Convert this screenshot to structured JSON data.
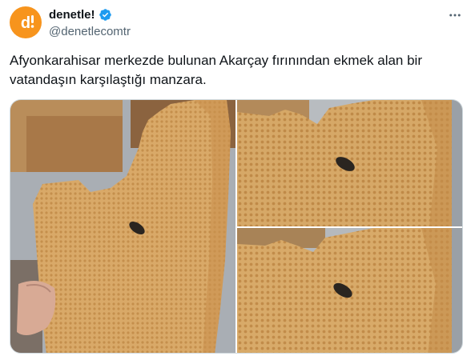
{
  "account": {
    "display_name": "denetle!",
    "handle": "@denetlecomtr",
    "avatar_icon": "denetle-logo",
    "verified_icon": "verified-badge-icon",
    "brand_color": "#f7941d"
  },
  "tweet": {
    "text": "Afyonkarahisar merkezde bulunan Akarçay fırınından ekmek alan bir vatandaşın karşılaştığı manzara."
  },
  "menu": {
    "more_icon": "more-horizontal-icon"
  },
  "media": {
    "count": 3,
    "photos": [
      "photo-1",
      "photo-2",
      "photo-3"
    ]
  }
}
